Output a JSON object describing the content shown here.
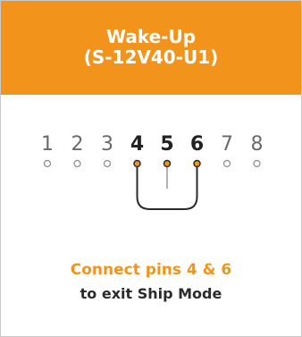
{
  "header": {
    "title_line1": "Wake-Up",
    "title_line2": "(S-12V40-U1)"
  },
  "pins": [
    {
      "label": "1",
      "active": false
    },
    {
      "label": "2",
      "active": false
    },
    {
      "label": "3",
      "active": false
    },
    {
      "label": "4",
      "active": true
    },
    {
      "label": "5",
      "active": true
    },
    {
      "label": "6",
      "active": true
    },
    {
      "label": "7",
      "active": false
    },
    {
      "label": "8",
      "active": false
    }
  ],
  "footer": {
    "instruction_line1": "Connect pins 4 & 6",
    "instruction_line2": "to exit Ship Mode"
  },
  "colors": {
    "accent": "#F2941B",
    "pin_active_text": "#222222",
    "pin_inactive_text": "#6a6a6a",
    "pin_inactive_circle": "#8a8a8a",
    "wire": "#2b2b2b",
    "stub": "#9a9a9a",
    "instruction_dark": "#2b2b2b"
  }
}
